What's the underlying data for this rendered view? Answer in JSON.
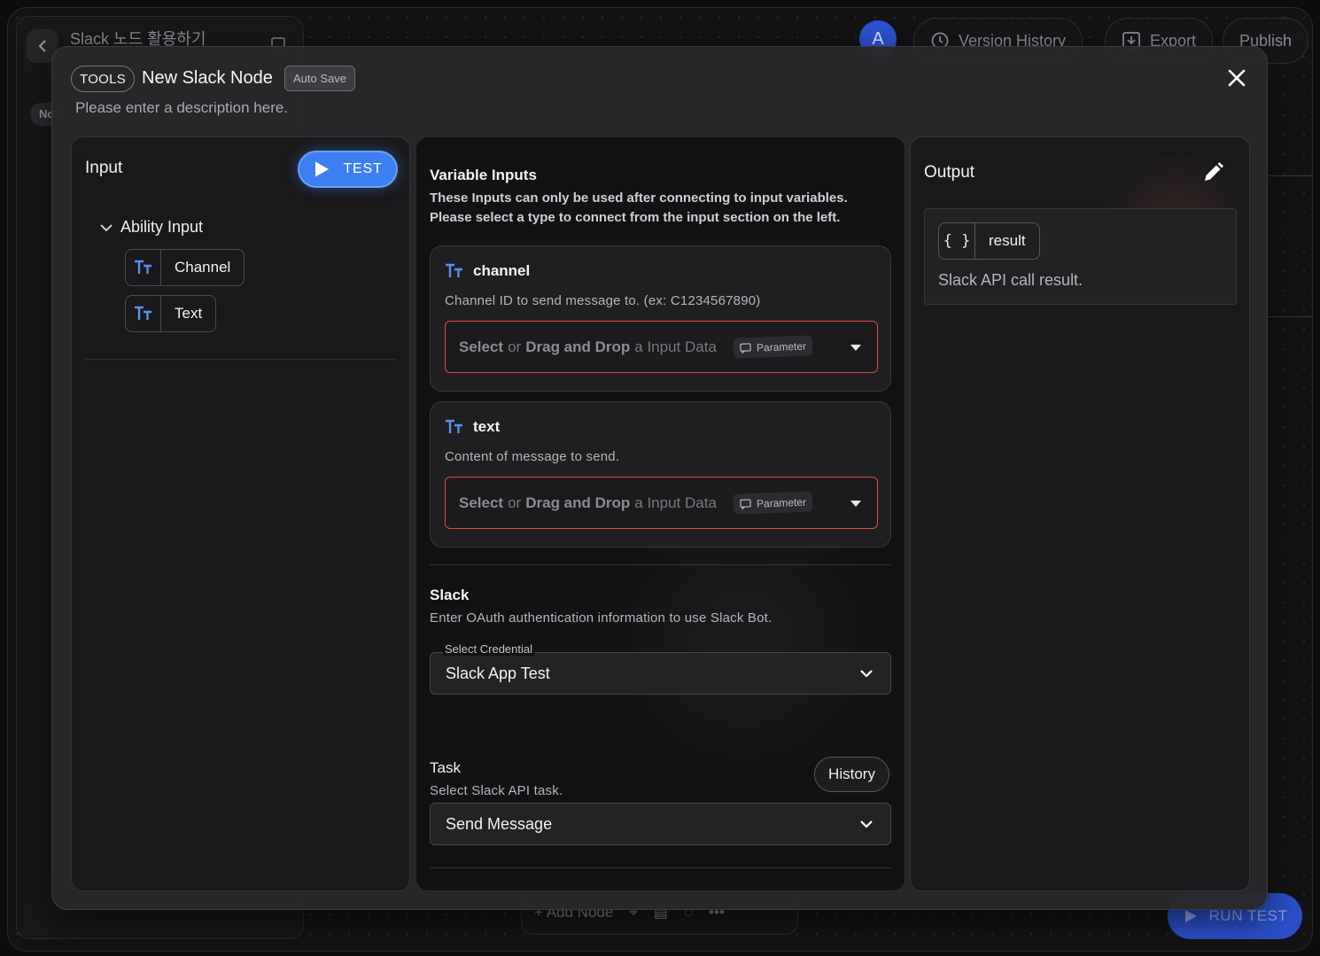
{
  "background": {
    "project_title": "Slack 노드 활용하기",
    "tab_badge": "No",
    "avatar_letter": "A",
    "version_history_label": "Version History",
    "export_label": "Export",
    "publish_label": "Publish",
    "add_node_label": "+ Add Node",
    "run_test_label": "RUN TEST"
  },
  "modal": {
    "category_badge": "TOOLS",
    "title": "New Slack Node",
    "autosave_label": "Auto Save",
    "description_placeholder": "Please enter a description here."
  },
  "input_panel": {
    "title": "Input",
    "test_label": "TEST",
    "group_label": "Ability Input",
    "items": [
      {
        "label": "Channel",
        "icon": "text-type-icon"
      },
      {
        "label": "Text",
        "icon": "text-type-icon"
      }
    ]
  },
  "variables": {
    "title": "Variable Inputs",
    "subtitle_line1": "These Inputs can only be used after connecting to input variables.",
    "subtitle_line2": "Please select a type to connect from the input section on the left.",
    "drop_select": "Select",
    "drop_or": "or",
    "drop_drag": "Drag and Drop",
    "drop_rest": "a Input Data",
    "param_label": "Parameter",
    "items": [
      {
        "name": "channel",
        "description": "Channel ID to send message to. (ex: C1234567890)"
      },
      {
        "name": "text",
        "description": "Content of message to send."
      }
    ]
  },
  "slack": {
    "title": "Slack",
    "description": "Enter OAuth authentication information to use Slack Bot.",
    "credential_label": "Select Credential",
    "credential_value": "Slack App Test"
  },
  "task": {
    "title": "Task",
    "description": "Select Slack API task.",
    "history_label": "History",
    "value": "Send Message"
  },
  "output_panel": {
    "title": "Output",
    "result_name": "result",
    "result_icon": "{ }",
    "result_description": "Slack API call result."
  },
  "colors": {
    "accent": "#3d7ff0",
    "error_border": "#d94a4a",
    "type_icon": "#5b8ff0"
  }
}
